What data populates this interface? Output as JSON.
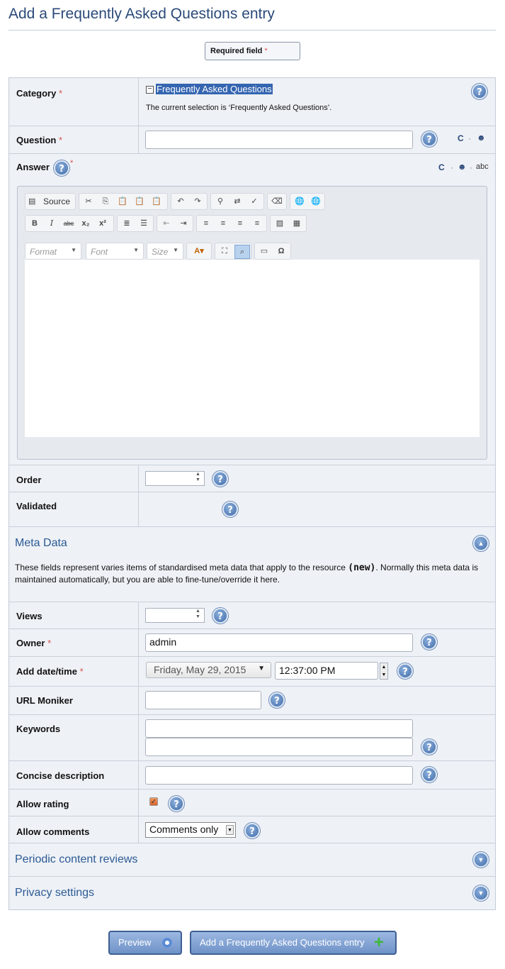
{
  "page": {
    "title": "Add a Frequently Asked Questions entry"
  },
  "required_note": {
    "label": "Required field",
    "star": "*"
  },
  "category": {
    "label": "Category",
    "star": "*",
    "tree_item": "Frequently Asked Questions",
    "tree_toggle": "−",
    "current_selection": "The current selection is ‘Frequently Asked Questions’."
  },
  "question": {
    "label": "Question",
    "star": "*",
    "value": ""
  },
  "answer": {
    "label": "Answer",
    "star": "*",
    "toolbar": {
      "source": "Source",
      "format": "Format",
      "font": "Font",
      "size": "Size"
    }
  },
  "tools": {
    "dot": "·",
    "spell": "abc"
  },
  "order": {
    "label": "Order",
    "value": ""
  },
  "validated": {
    "label": "Validated"
  },
  "meta": {
    "heading": "Meta Data",
    "desc_before": "These fields represent varies items of standardised meta data that apply to the resource ",
    "desc_code": "(new)",
    "desc_after": ". Normally this meta data is maintained automatically, but you are able to fine-tune/override it here."
  },
  "views": {
    "label": "Views",
    "value": ""
  },
  "owner": {
    "label": "Owner",
    "star": "*",
    "value": "admin"
  },
  "add_date": {
    "label": "Add date/time",
    "star": "*",
    "date": "Friday, May 29, 2015",
    "time": "12:37:00 PM"
  },
  "url_moniker": {
    "label": "URL Moniker",
    "value": ""
  },
  "keywords": {
    "label": "Keywords"
  },
  "concise": {
    "label": "Concise description"
  },
  "allow_rating": {
    "label": "Allow rating",
    "checked": true
  },
  "allow_comments": {
    "label": "Allow comments",
    "value": "Comments only"
  },
  "periodic": {
    "heading": "Periodic content reviews"
  },
  "privacy": {
    "heading": "Privacy settings"
  },
  "buttons": {
    "preview": "Preview",
    "submit": "Add a Frequently Asked Questions entry"
  },
  "colors": {
    "accent": "#2b4a7a",
    "required": "#d9534f",
    "panel": "#eef1f6",
    "selection": "#3465b0"
  },
  "icons": [
    "help-icon",
    "comcode-icon",
    "emoticon-icon",
    "spellcheck-icon",
    "collapse-icon",
    "expand-icon",
    "eye-icon",
    "plus-icon"
  ]
}
